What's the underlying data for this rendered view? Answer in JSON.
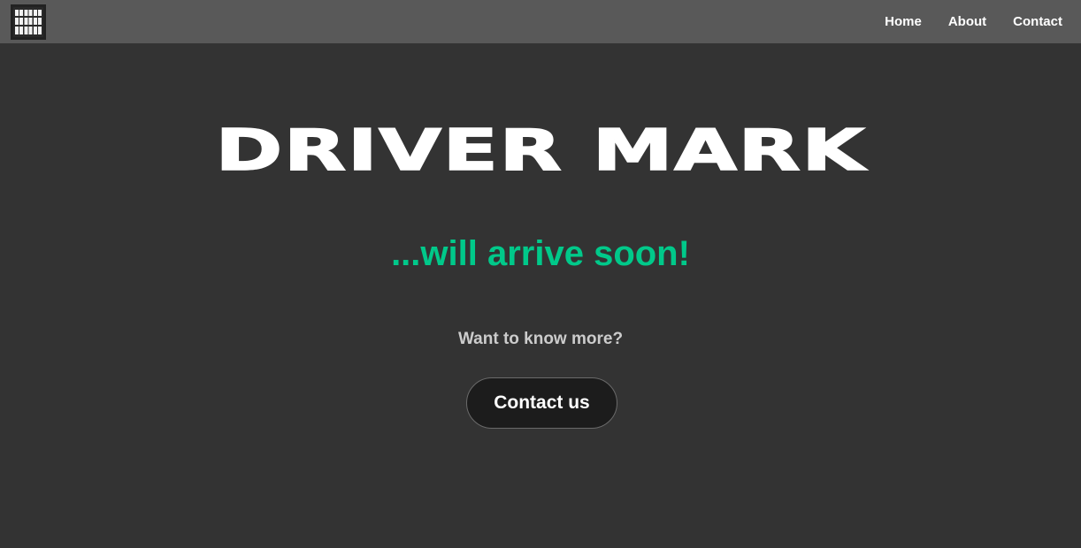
{
  "nav": {
    "logo_icon": "building-windows-logo-icon",
    "links": [
      {
        "label": "Home"
      },
      {
        "label": "About"
      },
      {
        "label": "Contact"
      }
    ]
  },
  "hero": {
    "title": "DRIVER MARK",
    "subtitle": "...will arrive soon!",
    "question": "Want to know more?",
    "cta_label": "Contact us"
  },
  "colors": {
    "background": "#333333",
    "navbar": "#595959",
    "accent": "#00c98a",
    "button_bg": "#1c1c1c"
  }
}
